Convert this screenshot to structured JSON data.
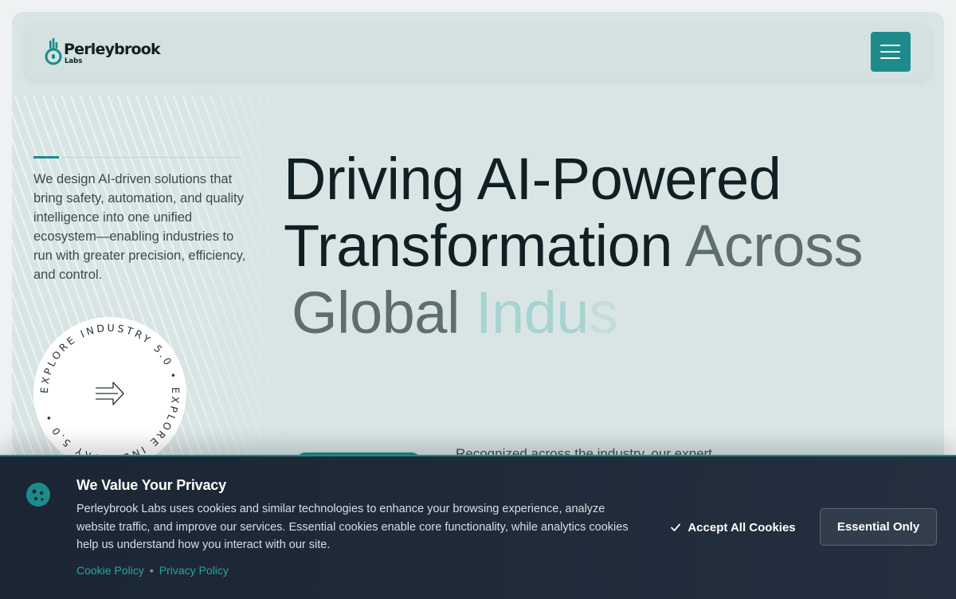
{
  "brand": {
    "name": "Perleybrook",
    "sub": "Labs",
    "accent_color": "#1d8b8b"
  },
  "nav": {
    "menu_icon": "hamburger-menu-icon"
  },
  "hero": {
    "intro": "We design AI-driven solutions that bring safety, automation, and quality intelligence into one unified ecosystem—enabling industries to run with greater precision, efficiency, and control.",
    "headline": {
      "part1": "Driving AI-Powered Transformation ",
      "part2": "Across",
      "part3": "Global ",
      "part4": "Indu",
      "part5": "s"
    },
    "badge": {
      "circular_text": "EXPLORE INDUSTRY 5.0 • EXPLORE INDUSTRY 5.0 • ",
      "icon": "arrow-right-icon"
    },
    "recognized_text": "Recognized across the industry, our expert"
  },
  "cookie_banner": {
    "icon": "cookie-icon",
    "title": "We Value Your Privacy",
    "body": "Perleybrook Labs uses cookies and similar technologies to enhance your browsing experience, analyze website traffic, and improve our services. Essential cookies enable core functionality, while analytics cookies help us understand how you interact with our site.",
    "cookie_policy_link": "Cookie Policy",
    "separator": "•",
    "privacy_policy_link": "Privacy Policy",
    "accept_label": "Accept All Cookies",
    "essential_label": "Essential Only",
    "banner_colors": {
      "background": "#1e2937",
      "link": "#2aa59f"
    }
  }
}
